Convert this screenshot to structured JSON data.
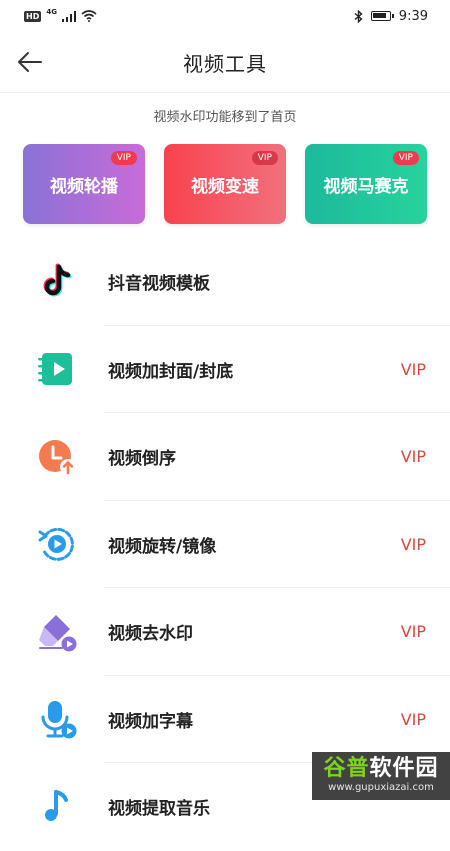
{
  "status_bar": {
    "hd": "HD",
    "network": "4G",
    "time": "9:39"
  },
  "header": {
    "title": "视频工具",
    "back_icon": "back-arrow-icon"
  },
  "notice": "视频水印功能移到了首页",
  "tiles": [
    {
      "label": "视频轮播",
      "vip": "VIP",
      "gradient": [
        "#8a72d6",
        "#c96bd9"
      ]
    },
    {
      "label": "视频变速",
      "vip": "VIP",
      "gradient": [
        "#f8424f",
        "#f2707d"
      ]
    },
    {
      "label": "视频马赛克",
      "vip": "VIP",
      "gradient": [
        "#1db99c",
        "#27d39c"
      ]
    }
  ],
  "tools": [
    {
      "label": "抖音视频模板",
      "vip": "",
      "icon": "tiktok-icon"
    },
    {
      "label": "视频加封面/封底",
      "vip": "VIP",
      "icon": "video-notebook-icon"
    },
    {
      "label": "视频倒序",
      "vip": "VIP",
      "icon": "reverse-clock-icon"
    },
    {
      "label": "视频旋转/镜像",
      "vip": "VIP",
      "icon": "rotate-play-icon"
    },
    {
      "label": "视频去水印",
      "vip": "VIP",
      "icon": "eraser-icon"
    },
    {
      "label": "视频加字幕",
      "vip": "VIP",
      "icon": "microphone-icon"
    },
    {
      "label": "视频提取音乐",
      "vip": "",
      "icon": "music-note-icon"
    }
  ],
  "watermark": {
    "title_part1": "谷普",
    "title_part2": "软件园",
    "url": "www.gupuxiazai.com"
  },
  "colors": {
    "vip_text": "#d9463e",
    "divider": "#eeeeee"
  }
}
